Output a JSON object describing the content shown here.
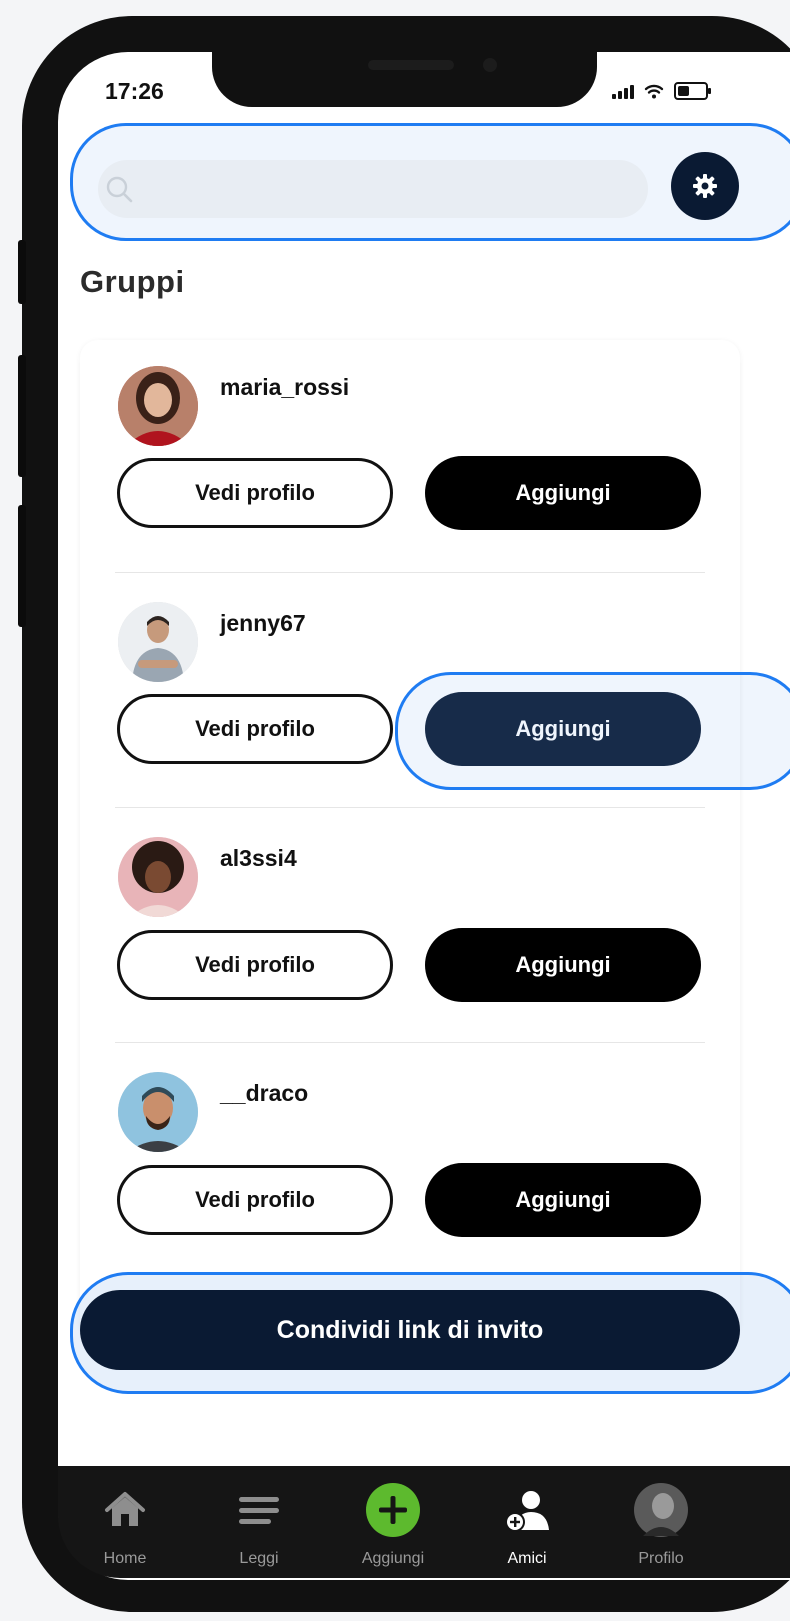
{
  "status_bar": {
    "time": "17:26"
  },
  "search": {
    "placeholder": ""
  },
  "section_title": "Gruppi",
  "users": [
    {
      "username": "maria_rossi",
      "view_label": "Vedi profilo",
      "add_label": "Aggiungi"
    },
    {
      "username": "jenny67",
      "view_label": "Vedi profilo",
      "add_label": "Aggiungi"
    },
    {
      "username": "al3ssi4",
      "view_label": "Vedi profilo",
      "add_label": "Aggiungi"
    },
    {
      "username": "__draco",
      "view_label": "Vedi profilo",
      "add_label": "Aggiungi"
    }
  ],
  "invite_button": "Condividi link di invito",
  "tabbar": {
    "active": "Amici",
    "items": [
      {
        "label": "Home",
        "icon": "home-icon"
      },
      {
        "label": "Leggi",
        "icon": "menu-icon"
      },
      {
        "label": "Aggiungi",
        "icon": "plus-icon"
      },
      {
        "label": "Amici",
        "icon": "add-friend-icon"
      },
      {
        "label": "Profilo",
        "icon": "profile-avatar"
      }
    ]
  },
  "colors": {
    "primary_dark": "#0a1a33",
    "highlight": "#1f7cf2",
    "plus_green": "#5dba2e"
  }
}
